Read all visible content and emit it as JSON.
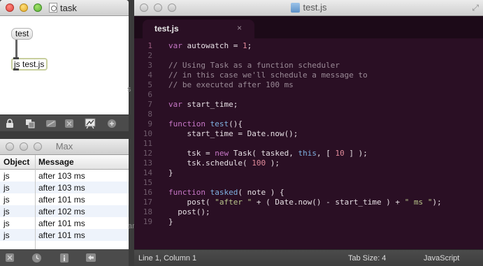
{
  "patcher": {
    "title": "task",
    "message_box": "test",
    "js_object": "js test.js",
    "toolbar_icons": [
      "lock-icon",
      "presentation-icon",
      "patchcord-icon",
      "clear-icon",
      "inspector-icon",
      "add-icon"
    ]
  },
  "console": {
    "title": "Max",
    "columns": [
      "Object",
      "Message"
    ],
    "rows": [
      {
        "object": "js",
        "message": "after 103 ms"
      },
      {
        "object": "js",
        "message": "after 103 ms"
      },
      {
        "object": "js",
        "message": "after 101 ms"
      },
      {
        "object": "js",
        "message": "after 102 ms"
      },
      {
        "object": "js",
        "message": "after 101 ms"
      },
      {
        "object": "js",
        "message": "after 101 ms"
      }
    ],
    "toolbar_icons": [
      "clear-icon",
      "clock-icon",
      "info-icon",
      "arrow-left-icon"
    ]
  },
  "editor": {
    "title": "test.js",
    "tab_label": "test.js",
    "tab_close": "×",
    "line_numbers": [
      "1",
      "2",
      "3",
      "4",
      "5",
      "6",
      "7",
      "8",
      "9",
      "10",
      "11",
      "12",
      "13",
      "14",
      "15",
      "16",
      "17",
      "18",
      "19"
    ],
    "status": {
      "position": "Line 1, Column 1",
      "tab_size": "Tab Size: 4",
      "syntax": "JavaScript"
    }
  },
  "code": {
    "l1_a": "var",
    "l1_b": " autowatch = ",
    "l1_c": "1",
    "l1_d": ";",
    "l3": "// Using Task as a function scheduler",
    "l4": "// in this case we'll schedule a message to",
    "l5": "// be executed after 100 ms",
    "l7_a": "var",
    "l7_b": " start_time;",
    "l9_a": "function",
    "l9_b": " ",
    "l9_c": "test",
    "l9_d": "(){",
    "l10": "    start_time = Date.now();",
    "l12_a": "    tsk = ",
    "l12_b": "new",
    "l12_c": " Task( tasked, ",
    "l12_d": "this",
    "l12_e": ", [ ",
    "l12_f": "10",
    "l12_g": " ] );",
    "l13_a": "    tsk.schedule( ",
    "l13_b": "100",
    "l13_c": " );",
    "l14": "}",
    "l16_a": "function",
    "l16_b": " ",
    "l16_c": "tasked",
    "l16_d": "( note ) {",
    "l17_a": "    post( ",
    "l17_b": "\"after \"",
    "l17_c": " + ( Date.now() - start_time ) + ",
    "l17_d": "\" ms \"",
    "l17_e": ");",
    "l18": "  post();",
    "l19": "}"
  },
  "background": {
    "stray_s": "s",
    "stray_ar": "ar"
  }
}
